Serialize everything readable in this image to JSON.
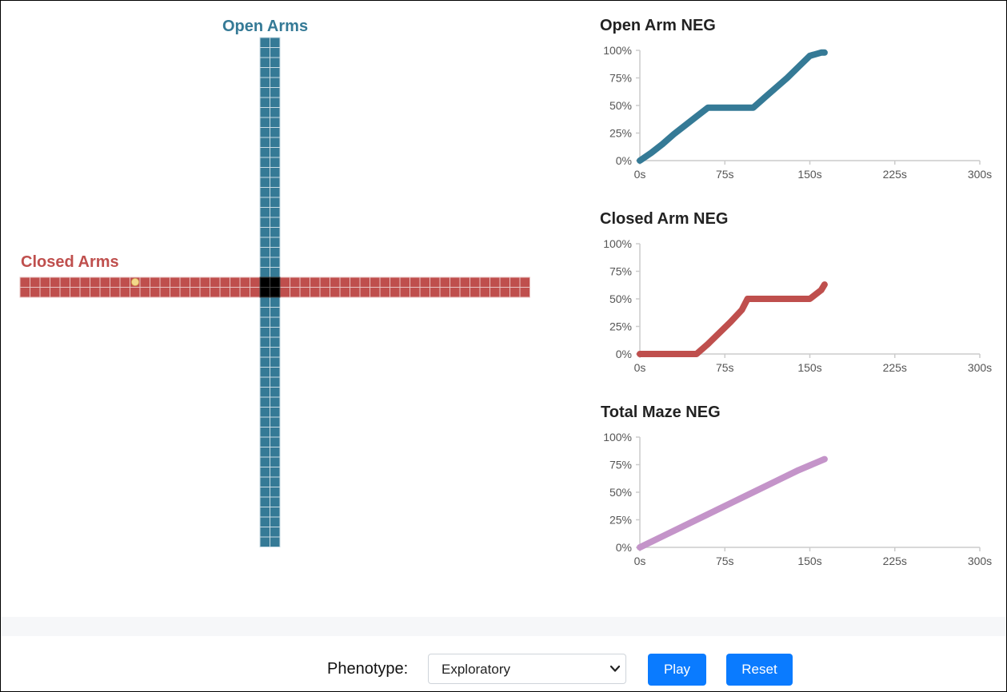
{
  "maze": {
    "open_label": "Open Arms",
    "closed_label": "Closed Arms",
    "colors": {
      "open": "#357a96",
      "closed": "#bf4f4d",
      "center": "#000000",
      "animal": "#f3d98a"
    }
  },
  "controls": {
    "phenotype_label": "Phenotype:",
    "phenotype_value": "Exploratory",
    "play_label": "Play",
    "reset_label": "Reset",
    "button_color": "#0a7bff"
  },
  "chart_data": [
    {
      "type": "line",
      "title": "Open Arm NEG",
      "xlabel": "",
      "ylabel": "",
      "xlim": [
        0,
        300
      ],
      "ylim": [
        0,
        100
      ],
      "x_ticks": [
        "0s",
        "75s",
        "150s",
        "225s",
        "300s"
      ],
      "y_ticks": [
        "0%",
        "25%",
        "50%",
        "75%",
        "100%"
      ],
      "color": "#357a96",
      "x": [
        0,
        10,
        20,
        30,
        40,
        50,
        60,
        70,
        80,
        90,
        100,
        110,
        120,
        130,
        140,
        150,
        160,
        163
      ],
      "y": [
        0,
        7,
        15,
        24,
        32,
        40,
        48,
        48,
        48,
        48,
        48,
        57,
        66,
        75,
        85,
        95,
        98,
        98
      ]
    },
    {
      "type": "line",
      "title": "Closed Arm NEG",
      "xlabel": "",
      "ylabel": "",
      "xlim": [
        0,
        300
      ],
      "ylim": [
        0,
        100
      ],
      "x_ticks": [
        "0s",
        "75s",
        "150s",
        "225s",
        "300s"
      ],
      "y_ticks": [
        "0%",
        "25%",
        "50%",
        "75%",
        "100%"
      ],
      "color": "#bf4f4d",
      "x": [
        0,
        10,
        20,
        30,
        40,
        50,
        60,
        70,
        80,
        90,
        95,
        100,
        110,
        120,
        130,
        140,
        150,
        160,
        163
      ],
      "y": [
        0,
        0,
        0,
        0,
        0,
        0,
        9,
        19,
        29,
        40,
        50,
        50,
        50,
        50,
        50,
        50,
        50,
        58,
        63
      ]
    },
    {
      "type": "line",
      "title": "Total Maze NEG",
      "xlabel": "",
      "ylabel": "",
      "xlim": [
        0,
        300
      ],
      "ylim": [
        0,
        100
      ],
      "x_ticks": [
        "0s",
        "75s",
        "150s",
        "225s",
        "300s"
      ],
      "y_ticks": [
        "0%",
        "25%",
        "50%",
        "75%",
        "100%"
      ],
      "color": "#c494c9",
      "x": [
        0,
        20,
        40,
        60,
        80,
        100,
        120,
        140,
        163
      ],
      "y": [
        0,
        10,
        20,
        30,
        40,
        50,
        60,
        70,
        80
      ]
    }
  ]
}
